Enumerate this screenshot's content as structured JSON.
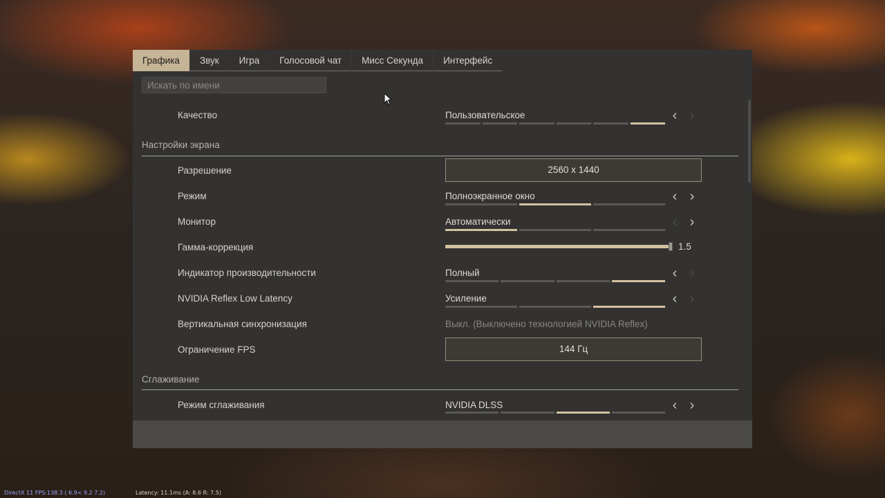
{
  "tabs": [
    "Графика",
    "Звук",
    "Игра",
    "Голосовой чат",
    "Мисс Секунда",
    "Интерфейс"
  ],
  "active_tab": "Графика",
  "search": {
    "placeholder": "Искать по имени"
  },
  "quality": {
    "label": "Качество",
    "value": "Пользовательское",
    "segments": 6,
    "selected": 6
  },
  "sections": {
    "screen": "Настройки экрана",
    "antialiasing": "Сглаживание"
  },
  "resolution": {
    "label": "Разрешение",
    "value": "2560 x 1440"
  },
  "mode": {
    "label": "Режим",
    "value": "Полноэкранное окно",
    "segments": 3,
    "selected": 2
  },
  "monitor": {
    "label": "Монитор",
    "value": "Автоматически",
    "segments": 3,
    "selected": 1
  },
  "gamma": {
    "label": "Гамма-коррекция",
    "value": "1.5",
    "fraction": 1.0
  },
  "perf_indicator": {
    "label": "Индикатор производительности",
    "value": "Полный",
    "segments": 4,
    "selected": 4
  },
  "reflex": {
    "label": "NVIDIA Reflex Low Latency",
    "value": "Усиление",
    "segments": 3,
    "selected": 3
  },
  "vsync": {
    "label": "Вертикальная синхронизация",
    "value": "Выкл. (Выключено технологией NVIDIA Reflex)"
  },
  "fps_limit": {
    "label": "Ограничение FPS",
    "value": "144 Гц"
  },
  "aa_mode": {
    "label": "Режим сглаживания",
    "value": "NVIDIA DLSS",
    "segments": 4,
    "selected": 3
  },
  "hud": {
    "left": "DirectX 11 FPS:138.3 ( 6.9< 9.2  7.2)",
    "right": "Latency: 11.1ms (A:  8.6  R:  7.5)"
  },
  "colors": {
    "accent": "#c6b496",
    "panel": "#333231",
    "segment_on": "#d3c29f"
  }
}
